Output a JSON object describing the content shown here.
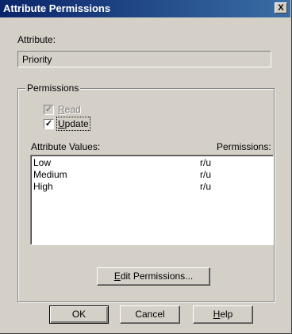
{
  "window": {
    "title": "Attribute Permissions",
    "close_glyph": "X"
  },
  "attribute": {
    "label": "Attribute:",
    "value": "Priority"
  },
  "permissions_group": {
    "title": "Permissions",
    "read": {
      "label_pre": "",
      "label_acc": "R",
      "label_post": "ead",
      "checked": true,
      "enabled": false
    },
    "update": {
      "label_pre": "",
      "label_acc": "U",
      "label_post": "pdate",
      "checked": true,
      "enabled": true
    },
    "values_header": "Attribute Values:",
    "permissions_header": "Permissions:",
    "rows": [
      {
        "value": "Low",
        "perm": "r/u"
      },
      {
        "value": "Medium",
        "perm": "r/u"
      },
      {
        "value": "High",
        "perm": "r/u"
      }
    ],
    "edit_button": {
      "acc": "E",
      "rest": "dit Permissions..."
    }
  },
  "buttons": {
    "ok": "OK",
    "cancel": "Cancel",
    "help_acc": "H",
    "help_rest": "elp"
  },
  "icons": {
    "check": "check-icon",
    "close": "close-icon"
  }
}
